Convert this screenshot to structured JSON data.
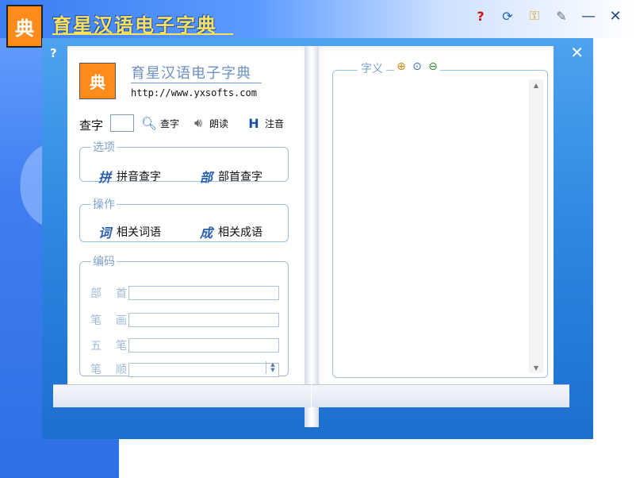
{
  "app": {
    "title": "育星汉语电子字典",
    "logo_glyph": "典",
    "watermark_glyph": "C"
  },
  "window_controls": {
    "help": "?",
    "update": "⟳",
    "key": "⚿",
    "settings": "✎",
    "minimize": "—",
    "close": "✕"
  },
  "dialog": {
    "help_label": "?",
    "close_label": "✕",
    "logo_glyph": "典",
    "title": "育星汉语电子字典",
    "url": "http://www.yxsofts.com",
    "search": {
      "label": "查字",
      "value": "",
      "lookup_label": "查字",
      "read_label": "朗读",
      "pinyin_label": "注音"
    },
    "options": {
      "legend": "选项",
      "pinyin_lookup": "拼音查字",
      "pinyin_icon": "拼",
      "radical_lookup": "部首查字",
      "radical_icon": "部"
    },
    "actions": {
      "legend": "操作",
      "related_words": "相关词语",
      "words_icon": "词",
      "related_idioms": "相关成语",
      "idioms_icon": "成"
    },
    "encoding": {
      "legend": "编码",
      "rows": [
        {
          "label": "部　首",
          "value": ""
        },
        {
          "label": "笔　画",
          "value": ""
        },
        {
          "label": "五　笔",
          "value": ""
        },
        {
          "label": "笔　顺",
          "value": ""
        }
      ]
    },
    "meaning": {
      "legend": "字义",
      "text": ""
    }
  },
  "colors": {
    "accent": "#2d86e0",
    "title_yellow": "#ffe25a",
    "logo_orange": "#ff8c1a",
    "legend_blue": "#7d9fcc"
  }
}
